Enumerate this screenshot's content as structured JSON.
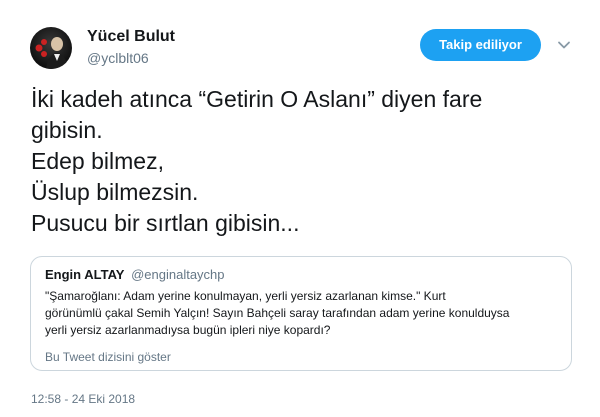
{
  "author": {
    "display_name": "Yücel Bulut",
    "handle": "@yclblt06",
    "avatar_icon": "user-avatar"
  },
  "follow_button": {
    "label": "Takip ediliyor",
    "color": "#1da1f2"
  },
  "menu_icon": "chevron-down-icon",
  "tweet": {
    "lines": [
      "İki kadeh atınca “Getirin O Aslanı” diyen fare",
      "gibisin.",
      "Edep bilmez,",
      "Üslup bilmezsin.",
      "Pusucu bir sırtlan gibisin..."
    ]
  },
  "quoted_tweet": {
    "display_name": "Engin ALTAY",
    "handle": "@enginaltaychp",
    "lines": [
      "\"Şamaroğlanı: Adam yerine konulmayan, yerli yersiz azarlanan kimse.\"       Kurt",
      "görünümlü çakal Semih Yalçın! Sayın Bahçeli saray tarafından adam yerine konulduysa",
      "yerli yersiz azarlanmadıysa bugün ipleri niye kopardı?"
    ],
    "thread_link": "Bu Tweet dizisini göster"
  },
  "timestamp": "12:58 - 24 Eki 2018",
  "colors": {
    "accent": "#1da1f2",
    "secondary_text": "#657786",
    "border": "#ccd6dd"
  }
}
